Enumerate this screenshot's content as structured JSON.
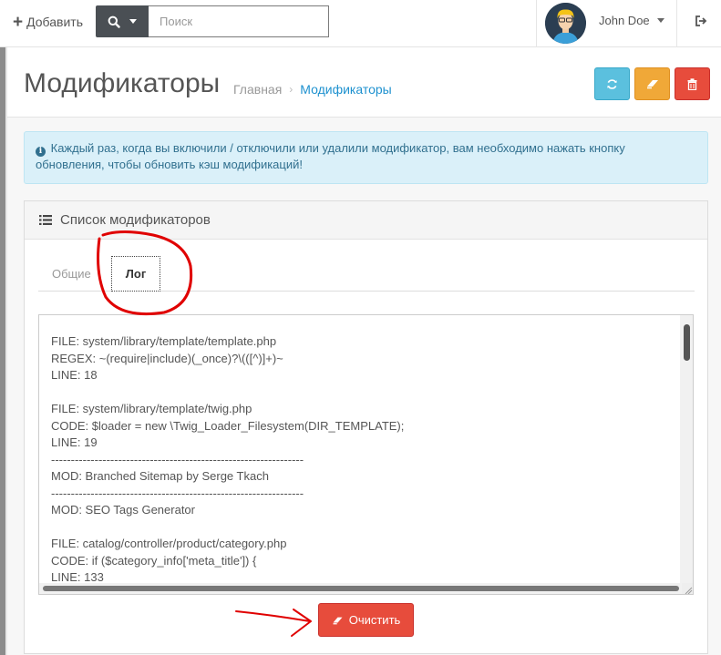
{
  "header": {
    "add_label": "Добавить",
    "search_placeholder": "Поиск",
    "user_name": "John Doe"
  },
  "page": {
    "title": "Модификаторы",
    "breadcrumb_home": "Главная",
    "breadcrumb_separator": "›",
    "breadcrumb_current": "Модификаторы"
  },
  "alert": {
    "text": "Каждый раз, когда вы включили / отключили или удалили модификатор, вам необходимо нажать кнопку обновления, чтобы обновить кэш модификаций!"
  },
  "panel": {
    "title": "Список модификаторов",
    "tabs": [
      {
        "label": "Общие",
        "active": false
      },
      {
        "label": "Лог",
        "active": true
      }
    ],
    "log_text": "FILE: system/library/template/template.php\nREGEX: ~(require|include)(_once)?\\(([^)]+)~\nLINE: 18\n\nFILE: system/library/template/twig.php\nCODE: $loader = new \\Twig_Loader_Filesystem(DIR_TEMPLATE);\nLINE: 19\n----------------------------------------------------------------\nMOD: Branched Sitemap by Serge Tkach\n----------------------------------------------------------------\nMOD: SEO Tags Generator\n\nFILE: catalog/controller/product/category.php\nCODE: if ($category_info['meta_title']) {\nLINE: 133",
    "clear_button": "Очистить"
  },
  "colors": {
    "refresh": "#5bc0de",
    "eraser": "#f0a838",
    "delete": "#e74c3c",
    "link": "#1e91cf",
    "annotation": "#e00000"
  },
  "icons": {
    "add": "plus-icon",
    "search": "search-icon",
    "dropdown": "caret-down-icon",
    "logout": "sign-out-icon",
    "refresh": "refresh-icon",
    "eraser": "eraser-icon",
    "delete": "trash-icon",
    "info": "info-circle-icon",
    "list": "list-icon"
  }
}
